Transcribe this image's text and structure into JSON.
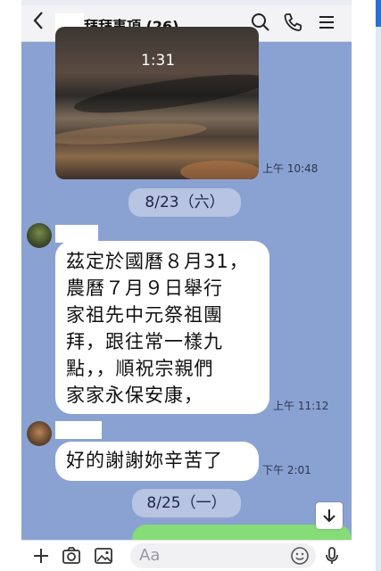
{
  "status_bar": {
    "text": "…"
  },
  "header": {
    "title": "拜拜事項 (26)",
    "back_icon": "chevron-left-icon",
    "search_icon": "search-icon",
    "call_icon": "phone-icon",
    "menu_icon": "menu-icon"
  },
  "messages": {
    "video": {
      "duration": "1:31",
      "time": "上午 10:48"
    },
    "date1": "8/23（六）",
    "msg1": {
      "text": "茲定於國曆８月31，\n農曆７月９日舉行\n家祖先中元祭祖團\n拜，跟往常一樣九\n點，，順祝宗親們\n家家永保安康，",
      "time": "上午 11:12"
    },
    "msg2": {
      "text": "好的謝謝妳辛苦了",
      "time": "下午 2:01"
    },
    "date2": "8/25（一）",
    "partial_outgoing": "…"
  },
  "input": {
    "placeholder": "Aa"
  },
  "colors": {
    "chat_bg": "#8aa2d2",
    "outgoing": "#86dc76",
    "pill": "#b7c4e2"
  }
}
